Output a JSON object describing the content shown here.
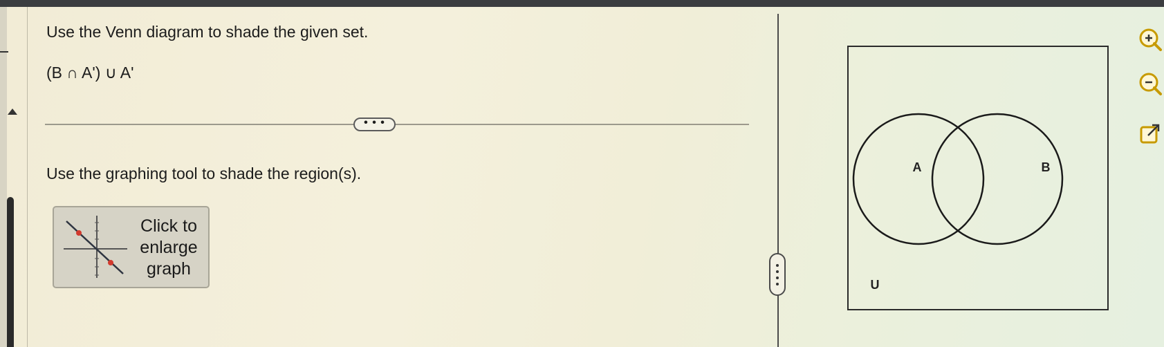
{
  "question": {
    "prompt": "Use the Venn diagram to shade the given set.",
    "set_expression": "(B ∩ A') ∪ A'"
  },
  "more_button": {
    "label": "• • •"
  },
  "instruction": "Use the graphing tool to shade the region(s).",
  "graph_button": {
    "label_lines": [
      "Click to",
      "enlarge",
      "graph"
    ]
  },
  "venn": {
    "set_a_label": "A",
    "set_b_label": "B",
    "universe_label": "U"
  },
  "tools": {
    "zoom_in_icon": "zoom-in-icon",
    "zoom_out_icon": "zoom-out-icon",
    "popout_icon": "popout-icon"
  },
  "colors": {
    "accent": "#c79a00",
    "outline": "#1a1a1a"
  }
}
